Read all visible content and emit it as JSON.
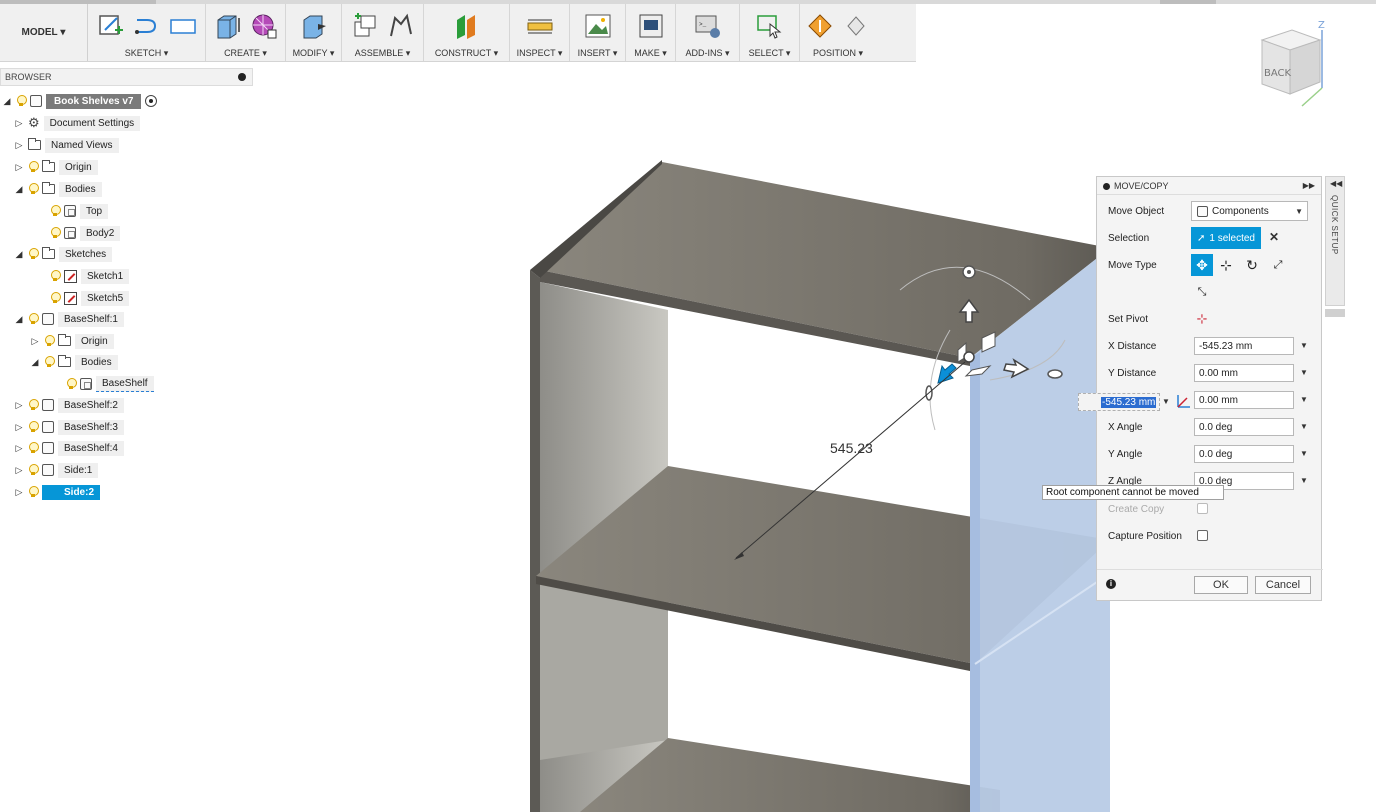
{
  "toolbar": {
    "model_label": "MODEL",
    "groups": [
      {
        "label": "SKETCH ▾"
      },
      {
        "label": "CREATE ▾"
      },
      {
        "label": "MODIFY ▾"
      },
      {
        "label": "ASSEMBLE ▾"
      },
      {
        "label": "CONSTRUCT ▾"
      },
      {
        "label": "INSPECT ▾"
      },
      {
        "label": "INSERT ▾"
      },
      {
        "label": "MAKE ▾"
      },
      {
        "label": "ADD-INS ▾"
      },
      {
        "label": "SELECT ▾"
      },
      {
        "label": "POSITION ▾"
      }
    ]
  },
  "browser": {
    "title": "BROWSER",
    "root": "Book Shelves v7",
    "items": [
      {
        "label": "Document Settings"
      },
      {
        "label": "Named Views"
      },
      {
        "label": "Origin"
      },
      {
        "label": "Bodies"
      },
      {
        "label": "Top"
      },
      {
        "label": "Body2"
      },
      {
        "label": "Sketches"
      },
      {
        "label": "Sketch1"
      },
      {
        "label": "Sketch5"
      },
      {
        "label": "BaseShelf:1"
      },
      {
        "label": "Origin"
      },
      {
        "label": "Bodies"
      },
      {
        "label": "BaseShelf"
      },
      {
        "label": "BaseShelf:2"
      },
      {
        "label": "BaseShelf:3"
      },
      {
        "label": "BaseShelf:4"
      },
      {
        "label": "Side:1"
      },
      {
        "label": "Side:2"
      }
    ]
  },
  "viewcube": {
    "face": "BACK",
    "axis_z": "Z"
  },
  "move_copy": {
    "title": "MOVE/COPY",
    "move_object_label": "Move Object",
    "move_object_value": "Components",
    "selection_label": "Selection",
    "selection_value": "1 selected",
    "move_type_label": "Move Type",
    "set_pivot_label": "Set Pivot",
    "x_distance_label": "X Distance",
    "x_distance_value": "-545.23 mm",
    "y_distance_label": "Y Distance",
    "y_distance_value": "0.00 mm",
    "z_distance_value": "0.00 mm",
    "x_angle_label": "X Angle",
    "x_angle_value": "0.0 deg",
    "y_angle_label": "Y Angle",
    "y_angle_value": "0.0 deg",
    "z_angle_label": "Z Angle",
    "z_angle_value": "0.0 deg",
    "create_copy_label": "Create Copy",
    "capture_position_label": "Capture Position",
    "ok_label": "OK",
    "cancel_label": "Cancel"
  },
  "quick_setup": {
    "label": "QUICK SETUP"
  },
  "floating_input": {
    "value": "-545.23 mm"
  },
  "tooltip": {
    "text": "Root component cannot be moved"
  },
  "dimension": {
    "value": "545.23"
  },
  "colors": {
    "accent": "#0696d7",
    "shelf_top": "#7a756c",
    "panel_selected": "#b8cbe6"
  }
}
